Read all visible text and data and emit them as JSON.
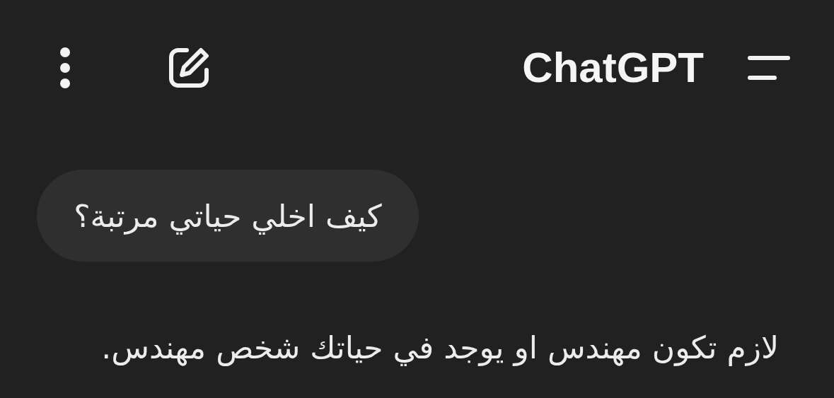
{
  "header": {
    "title": "ChatGPT"
  },
  "messages": [
    {
      "kind": "user",
      "text": "كيف اخلي حياتي مرتبة؟"
    },
    {
      "kind": "assistant",
      "text": "لازم تكون مهندس او يوجد في حياتك شخص مهندس."
    }
  ]
}
